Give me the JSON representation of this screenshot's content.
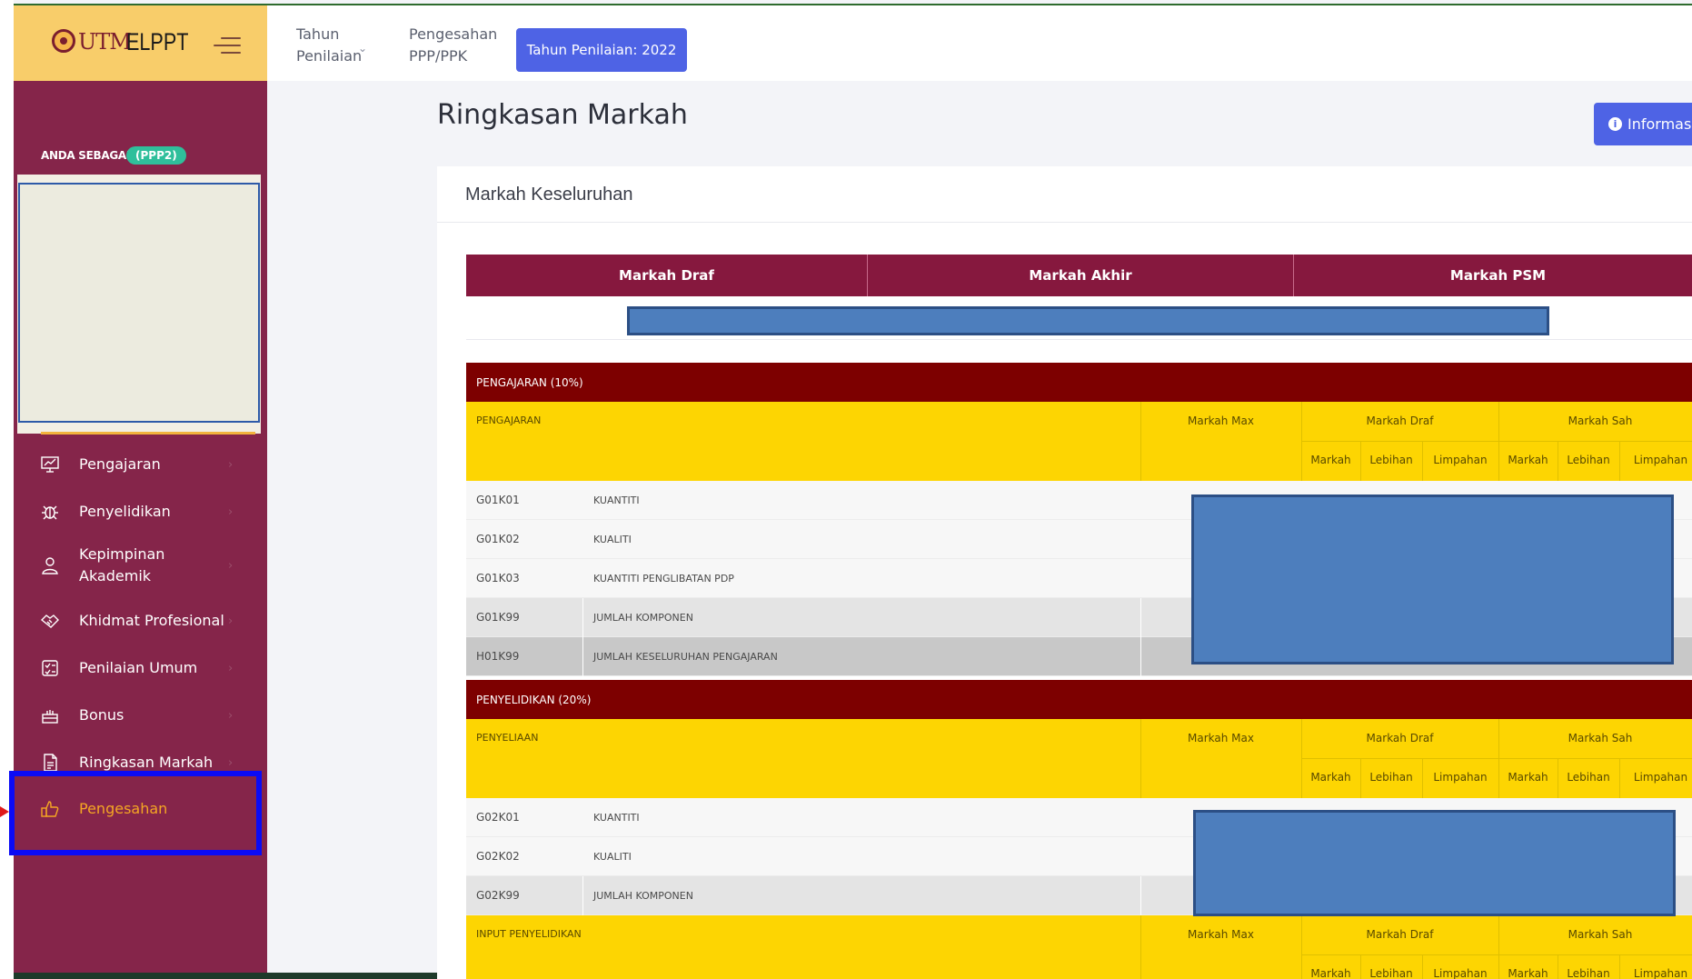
{
  "app": {
    "logo_text": "UTM",
    "app_name": "ELPPT"
  },
  "sidebar": {
    "role_label": "ANDA SEBAGAI",
    "role_badge": "(PPP2)",
    "items": [
      {
        "label": "Pengajaran",
        "icon": "presentation-chart-icon",
        "active": false
      },
      {
        "label": "Penyelidikan",
        "icon": "bug-research-icon",
        "active": false
      },
      {
        "label": "Kepimpinan Akademik",
        "icon": "person-user-icon",
        "active": false
      },
      {
        "label": "Khidmat Profesional",
        "icon": "handshake-icon",
        "active": false
      },
      {
        "label": "Penilaian Umum",
        "icon": "document-checklist-icon",
        "active": false
      },
      {
        "label": "Bonus",
        "icon": "cake-gift-icon",
        "active": false
      },
      {
        "label": "Ringkasan Markah",
        "icon": "document-report-icon",
        "active": false
      },
      {
        "label": "Pengesahan",
        "icon": "thumbs-up-icon",
        "active": true
      }
    ]
  },
  "topbar": {
    "menu_year": "Tahun Penilaian",
    "menu_confirm": "Pengesahan PPP/PPK",
    "year_button": "Tahun Penilaian: 2022"
  },
  "main": {
    "title": "Ringkasan Markah",
    "info_button": "Informasi",
    "card_title": "Markah Keseluruhan"
  },
  "summary": {
    "headers": [
      "Markah Draf",
      "Markah Akhir",
      "Markah PSM"
    ]
  },
  "columns": {
    "max": "Markah Max",
    "draf": "Markah Draf",
    "sah": "Markah Sah",
    "markah": "Markah",
    "lebihan": "Lebihan",
    "limpahan": "Limpahan"
  },
  "sections": [
    {
      "title": "PENGAJARAN (10%)",
      "subheader": "PENGAJARAN",
      "rows": [
        {
          "code": "G01K01",
          "desc": "KUANTITI",
          "shade": "light"
        },
        {
          "code": "G01K02",
          "desc": "KUALITI",
          "shade": "light"
        },
        {
          "code": "G01K03",
          "desc": "KUANTITI PENGLIBATAN PDP",
          "shade": "light"
        },
        {
          "code": "G01K99",
          "desc": "JUMLAH KOMPONEN",
          "shade": "mid"
        },
        {
          "code": "H01K99",
          "desc": "JUMLAH KESELURUHAN PENGAJARAN",
          "shade": "dark"
        }
      ]
    },
    {
      "title": "PENYELIDIKAN (20%)",
      "subheader": "PENYELIAAN",
      "rows": [
        {
          "code": "G02K01",
          "desc": "KUANTITI",
          "shade": "light"
        },
        {
          "code": "G02K02",
          "desc": "KUALITI",
          "shade": "light"
        },
        {
          "code": "G02K99",
          "desc": "JUMLAH KOMPONEN",
          "shade": "mid"
        }
      ],
      "subheader2": "INPUT PENYELIDIKAN"
    }
  ],
  "colors": {
    "sidebar_bg": "#85254a",
    "brand_bg": "#f8cd6a",
    "accent_blue": "#4e63e5",
    "section_red": "#7d0000",
    "summary_header": "#86183e",
    "subheader_yellow": "#fdd502",
    "active_nav": "#f5a623"
  }
}
